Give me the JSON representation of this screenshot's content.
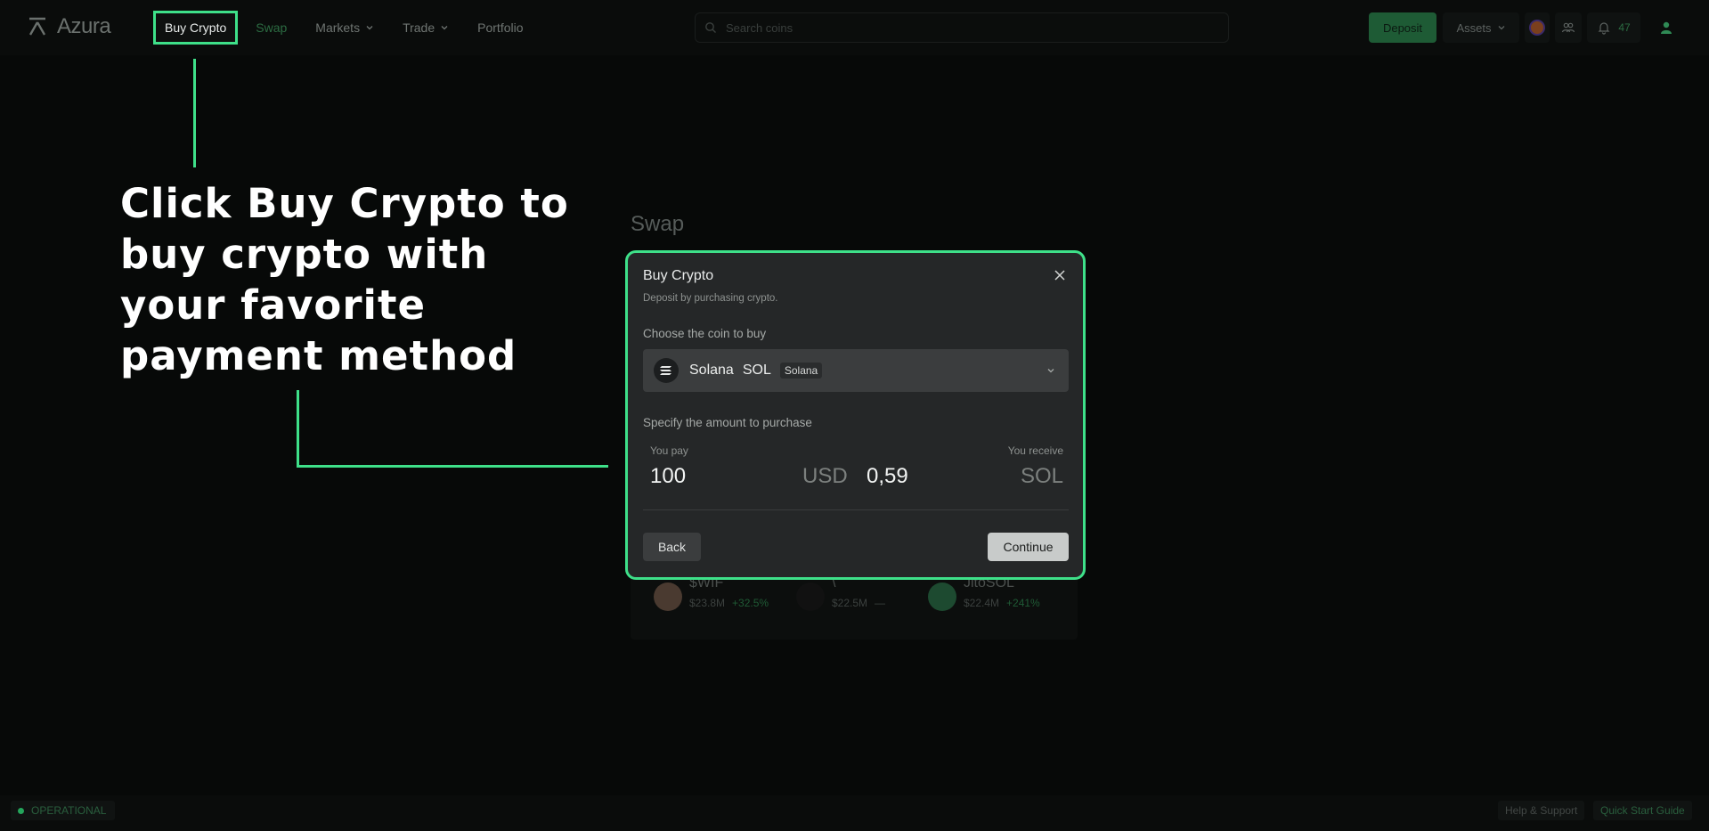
{
  "brand": {
    "name": "Azura"
  },
  "nav": {
    "buy_crypto": "Buy Crypto",
    "swap": "Swap",
    "markets": "Markets",
    "trade": "Trade",
    "portfolio": "Portfolio"
  },
  "search": {
    "placeholder": "Search coins"
  },
  "header_actions": {
    "deposit": "Deposit",
    "assets": "Assets",
    "notification_count": "47"
  },
  "annotation": {
    "text": "Click Buy Crypto to buy crypto with your favorite payment method",
    "highlight_color": "#3ee089"
  },
  "background": {
    "swap_title": "Swap",
    "tokens": [
      {
        "name": "$WIF",
        "volume": "$23.8M",
        "change": "+32.5%"
      },
      {
        "name": "\\",
        "volume": "$22.5M",
        "change": "—"
      },
      {
        "name": "JitoSOL",
        "volume": "$22.4M",
        "change": "+241%"
      }
    ]
  },
  "modal": {
    "title": "Buy Crypto",
    "subtitle": "Deposit by purchasing crypto.",
    "choose_label": "Choose the coin to buy",
    "coin": {
      "name": "Solana",
      "symbol": "SOL",
      "network": "Solana"
    },
    "amount_label": "Specify the amount to purchase",
    "pay_label": "You pay",
    "pay_amount": "100",
    "pay_currency": "USD",
    "receive_label": "You receive",
    "receive_amount": "0,59",
    "receive_currency": "SOL",
    "back": "Back",
    "continue": "Continue"
  },
  "footer": {
    "status": "OPERATIONAL",
    "help": "Help & Support",
    "guide": "Quick Start Guide"
  },
  "colors": {
    "accent": "#3ee089",
    "deposit_bg": "#1e5b35",
    "modal_bg": "#252728"
  }
}
